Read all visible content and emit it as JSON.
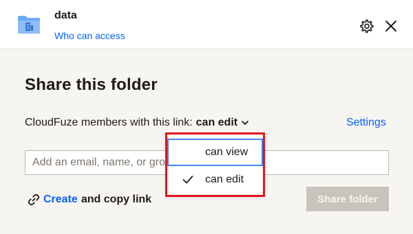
{
  "header": {
    "folder_name": "data",
    "who_can_access": "Who can access",
    "folder_icon": "folder-icon",
    "settings_icon": "gear-icon",
    "close_icon": "close-icon"
  },
  "title": "Share this folder",
  "permission": {
    "prefix": "CloudFuze members with this link:",
    "value": "can edit",
    "settings_label": "Settings"
  },
  "invite": {
    "placeholder": "Add an email, name, or group"
  },
  "link": {
    "create_label": "Create",
    "rest_label": "and copy link"
  },
  "share_button_label": "Share folder",
  "dropdown": {
    "items": [
      {
        "label": "can view",
        "selected": false,
        "focused": true
      },
      {
        "label": "can edit",
        "selected": true,
        "focused": false
      }
    ]
  },
  "colors": {
    "accent": "#0061fe",
    "background": "#f7f5f2",
    "highlight_box": "#e1141e",
    "focus_ring": "#3b86f2",
    "disabled_button": "#c9c3bc"
  }
}
